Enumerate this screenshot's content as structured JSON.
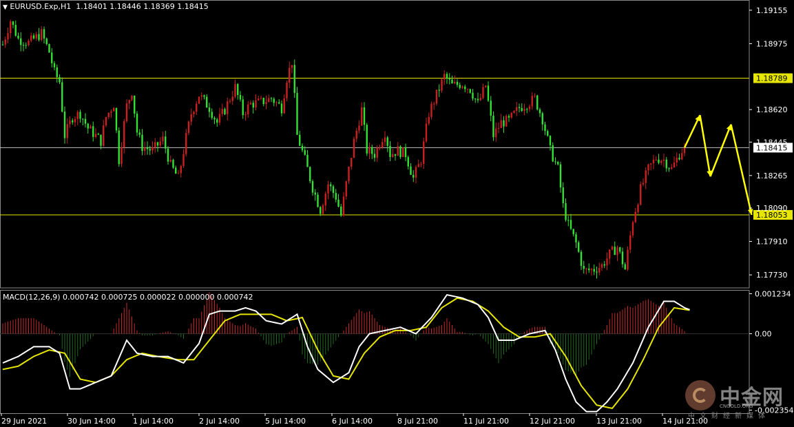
{
  "header": {
    "arrow": "▼",
    "symbol": "EURUSD.Exp,H1",
    "ohlc": "1.18401 1.18446 1.18369 1.18415"
  },
  "colors": {
    "bull": "#cc2020",
    "bear": "#33e233",
    "level_line": "#e6e600",
    "grid_line": "#c0c0c0",
    "macd_line": "#ffffff",
    "signal_line": "#e6e600",
    "hist_pos": "#c8282a",
    "hist_neg": "#1f6b1f",
    "arrow": "#ffff00",
    "axis_text": "#ffffff"
  },
  "macd_label": "MACD(12,26,9) 0.000742 0.000725 0.000022 0.000000 0.000742",
  "watermark": {
    "title": "中金网",
    "sub": "CNGOLD.ORG",
    "sub2": "中文财经新媒体"
  },
  "chart_data": [
    {
      "type": "candlestick",
      "title": "EURUSD.Exp,H1",
      "y_ticks": [
        "1.19155",
        "1.18975",
        "1.18620",
        "1.18445",
        "1.18265",
        "1.18090",
        "1.17910",
        "1.17730"
      ],
      "y_tick_values": [
        1.19155,
        1.18975,
        1.1862,
        1.18445,
        1.18265,
        1.1809,
        1.1791,
        1.1773
      ],
      "ylim": [
        1.1766,
        1.1921
      ],
      "x_ticks": [
        "29 Jun 2021",
        "30 Jun 14:00",
        "1 Jul 14:00",
        "2 Jul 14:00",
        "5 Jul 14:00",
        "6 Jul 14:00",
        "8 Jul 21:00",
        "11 Jul 21:00",
        "12 Jul 21:00",
        "13 Jul 21:00",
        "14 Jul 21:00"
      ],
      "levels": [
        {
          "value": 1.18789,
          "label": "1.18789",
          "style": "yellow"
        },
        {
          "value": 1.18415,
          "label": "1.18415",
          "style": "price"
        },
        {
          "value": 1.18053,
          "label": "1.18053",
          "style": "yellow"
        }
      ],
      "last_price": 1.18415,
      "close_path": [
        [
          0,
          1.1897
        ],
        [
          3,
          1.191
        ],
        [
          6,
          1.19
        ],
        [
          10,
          1.1898
        ],
        [
          15,
          1.1903
        ],
        [
          18,
          1.1893
        ],
        [
          20,
          1.1882
        ],
        [
          22,
          1.1877
        ],
        [
          24,
          1.1848
        ],
        [
          27,
          1.1858
        ],
        [
          30,
          1.186
        ],
        [
          33,
          1.1852
        ],
        [
          36,
          1.1848
        ],
        [
          38,
          1.1845
        ],
        [
          40,
          1.1858
        ],
        [
          43,
          1.1865
        ],
        [
          45,
          1.1835
        ],
        [
          48,
          1.1864
        ],
        [
          50,
          1.1872
        ],
        [
          52,
          1.185
        ],
        [
          54,
          1.1842
        ],
        [
          58,
          1.184
        ],
        [
          62,
          1.1846
        ],
        [
          65,
          1.1832
        ],
        [
          68,
          1.1825
        ],
        [
          71,
          1.1847
        ],
        [
          73,
          1.186
        ],
        [
          76,
          1.187
        ],
        [
          80,
          1.1863
        ],
        [
          83,
          1.1855
        ],
        [
          86,
          1.1862
        ],
        [
          90,
          1.1874
        ],
        [
          93,
          1.186
        ],
        [
          96,
          1.1865
        ],
        [
          100,
          1.1866
        ],
        [
          104,
          1.1868
        ],
        [
          108,
          1.1863
        ],
        [
          110,
          1.1879
        ],
        [
          112,
          1.1888
        ],
        [
          114,
          1.1848
        ],
        [
          117,
          1.1835
        ],
        [
          120,
          1.182
        ],
        [
          123,
          1.1808
        ],
        [
          126,
          1.1822
        ],
        [
          129,
          1.1815
        ],
        [
          131,
          1.1805
        ],
        [
          133,
          1.1822
        ],
        [
          136,
          1.1845
        ],
        [
          139,
          1.1862
        ],
        [
          141,
          1.184
        ],
        [
          144,
          1.1838
        ],
        [
          148,
          1.185
        ],
        [
          150,
          1.1838
        ],
        [
          153,
          1.184
        ],
        [
          156,
          1.1838
        ],
        [
          159,
          1.1825
        ],
        [
          162,
          1.1835
        ],
        [
          165,
          1.186
        ],
        [
          168,
          1.187
        ],
        [
          171,
          1.188
        ],
        [
          174,
          1.1875
        ],
        [
          178,
          1.1876
        ],
        [
          181,
          1.1873
        ],
        [
          184,
          1.1865
        ],
        [
          187,
          1.1875
        ],
        [
          190,
          1.1848
        ],
        [
          193,
          1.1855
        ],
        [
          196,
          1.1856
        ],
        [
          200,
          1.1863
        ],
        [
          204,
          1.1866
        ],
        [
          206,
          1.1868
        ],
        [
          209,
          1.1857
        ],
        [
          212,
          1.184
        ],
        [
          215,
          1.183
        ],
        [
          217,
          1.181
        ],
        [
          219,
          1.18
        ],
        [
          222,
          1.179
        ],
        [
          225,
          1.1775
        ],
        [
          229,
          1.1776
        ],
        [
          232,
          1.1778
        ],
        [
          235,
          1.1784
        ],
        [
          238,
          1.1788
        ],
        [
          241,
          1.1776
        ],
        [
          244,
          1.1803
        ],
        [
          247,
          1.1819
        ],
        [
          250,
          1.183
        ],
        [
          253,
          1.1836
        ],
        [
          256,
          1.1835
        ],
        [
          259,
          1.183
        ],
        [
          262,
          1.1838
        ],
        [
          264,
          1.1842
        ]
      ],
      "forecast_arrows": [
        [
          [
            264,
            1.18415
          ],
          [
            270,
            1.1859
          ]
        ],
        [
          [
            270,
            1.1859
          ],
          [
            274,
            1.1826
          ]
        ],
        [
          [
            274,
            1.1826
          ],
          [
            282,
            1.1854
          ]
        ],
        [
          [
            282,
            1.1854
          ],
          [
            290,
            1.18053
          ]
        ]
      ]
    },
    {
      "type": "macd",
      "title": "MACD(12,26,9) 0.000742 0.000725 0.000022 0.000000 0.000742",
      "y_ticks": [
        "0.001234",
        "0.00",
        "-0.002354"
      ],
      "y_tick_values": [
        0.001234,
        0.0,
        -0.002354
      ],
      "ylim": [
        -0.00245,
        0.00135
      ],
      "macd_path": [
        [
          0,
          -0.0009
        ],
        [
          6,
          -0.0007
        ],
        [
          12,
          -0.0004
        ],
        [
          18,
          -0.0004
        ],
        [
          22,
          -0.0006
        ],
        [
          26,
          -0.0017
        ],
        [
          30,
          -0.0017
        ],
        [
          36,
          -0.0015
        ],
        [
          42,
          -0.0013
        ],
        [
          48,
          -0.0002
        ],
        [
          52,
          -0.0006
        ],
        [
          58,
          -0.0007
        ],
        [
          64,
          -0.0007
        ],
        [
          70,
          -0.0009
        ],
        [
          76,
          -0.0003
        ],
        [
          80,
          0.0006
        ],
        [
          84,
          0.0007
        ],
        [
          90,
          0.0007
        ],
        [
          94,
          0.0008
        ],
        [
          98,
          0.0007
        ],
        [
          102,
          0.0004
        ],
        [
          108,
          0.0003
        ],
        [
          114,
          0.0006
        ],
        [
          118,
          -0.0004
        ],
        [
          122,
          -0.0011
        ],
        [
          128,
          -0.0015
        ],
        [
          134,
          -0.0012
        ],
        [
          138,
          -0.0004
        ],
        [
          142,
          0.0
        ],
        [
          148,
          0.0001
        ],
        [
          154,
          0.0002
        ],
        [
          160,
          0.0
        ],
        [
          166,
          0.0005
        ],
        [
          172,
          0.0012
        ],
        [
          178,
          0.0011
        ],
        [
          184,
          0.0009
        ],
        [
          188,
          0.0005
        ],
        [
          192,
          -0.0002
        ],
        [
          198,
          -0.0002
        ],
        [
          204,
          0.0
        ],
        [
          210,
          0.0001
        ],
        [
          214,
          -0.0005
        ],
        [
          218,
          -0.0014
        ],
        [
          222,
          -0.0021
        ],
        [
          226,
          -0.0024
        ],
        [
          230,
          -0.0024
        ],
        [
          234,
          -0.0021
        ],
        [
          238,
          -0.0017
        ],
        [
          244,
          -0.0009
        ],
        [
          250,
          0.0002
        ],
        [
          256,
          0.001
        ],
        [
          260,
          0.001
        ],
        [
          264,
          0.0008
        ],
        [
          266,
          0.00074
        ]
      ],
      "signal_path": [
        [
          0,
          -0.0011
        ],
        [
          6,
          -0.001
        ],
        [
          12,
          -0.0007
        ],
        [
          18,
          -0.0005
        ],
        [
          24,
          -0.0006
        ],
        [
          30,
          -0.0014
        ],
        [
          36,
          -0.0015
        ],
        [
          42,
          -0.0013
        ],
        [
          48,
          -0.0008
        ],
        [
          54,
          -0.0006
        ],
        [
          60,
          -0.0007
        ],
        [
          68,
          -0.0008
        ],
        [
          74,
          -0.0008
        ],
        [
          80,
          -0.0002
        ],
        [
          86,
          0.0004
        ],
        [
          92,
          0.0006
        ],
        [
          98,
          0.0006
        ],
        [
          104,
          0.0006
        ],
        [
          110,
          0.0004
        ],
        [
          116,
          0.0005
        ],
        [
          122,
          -0.0005
        ],
        [
          128,
          -0.0013
        ],
        [
          134,
          -0.0014
        ],
        [
          140,
          -0.0006
        ],
        [
          146,
          -0.0001
        ],
        [
          152,
          0.0001
        ],
        [
          158,
          0.0001
        ],
        [
          164,
          0.0002
        ],
        [
          170,
          0.0008
        ],
        [
          176,
          0.0011
        ],
        [
          182,
          0.001
        ],
        [
          188,
          0.0007
        ],
        [
          194,
          0.0002
        ],
        [
          200,
          -0.0001
        ],
        [
          206,
          -0.0001
        ],
        [
          212,
          0.0
        ],
        [
          218,
          -0.0007
        ],
        [
          224,
          -0.0016
        ],
        [
          230,
          -0.0022
        ],
        [
          236,
          -0.0023
        ],
        [
          242,
          -0.0017
        ],
        [
          248,
          -0.0008
        ],
        [
          254,
          0.0002
        ],
        [
          260,
          0.0008
        ],
        [
          264,
          0.00075
        ],
        [
          266,
          0.000725
        ]
      ]
    }
  ]
}
